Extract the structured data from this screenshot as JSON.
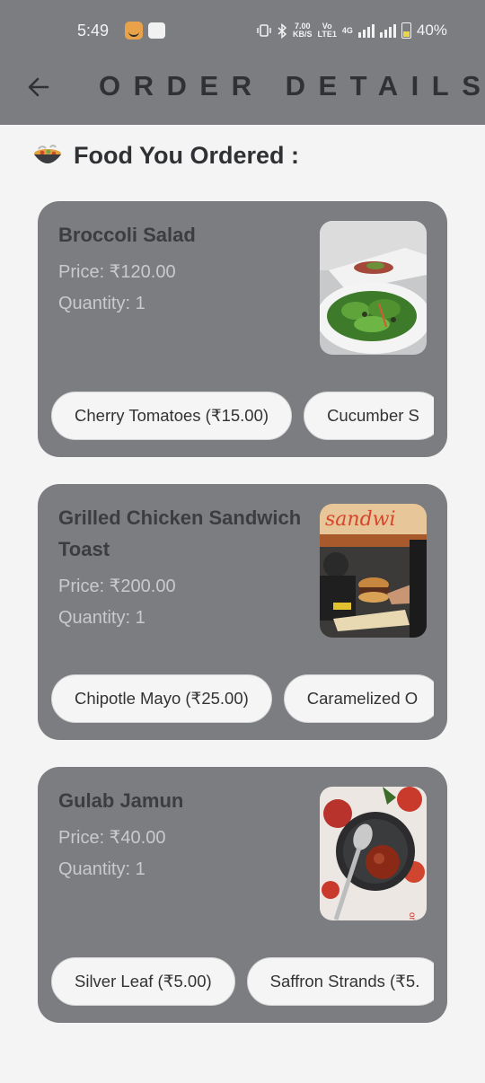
{
  "status_bar": {
    "time": "5:49",
    "speed_top": "7.00",
    "speed_bottom": "KB/S",
    "volte_top": "Vo",
    "volte_bottom": "LTE1",
    "network": "4G",
    "battery_percent": "40%"
  },
  "app_bar": {
    "title": "ORDER DETAILS"
  },
  "section": {
    "heading": "Food You Ordered :",
    "icon": "food-bowl-icon"
  },
  "orders": [
    {
      "name": "Broccoli Salad",
      "price": "Price: ₹120.00",
      "quantity": "Quantity: 1",
      "addons": [
        "Cherry Tomatoes (₹15.00)",
        "Cucumber S"
      ]
    },
    {
      "name": "Grilled Chicken Sandwich Toast",
      "price": "Price: ₹200.00",
      "quantity": "Quantity: 1",
      "addons": [
        "Chipotle Mayo (₹25.00)",
        "Caramelized O"
      ]
    },
    {
      "name": "Gulab Jamun",
      "price": "Price: ₹40.00",
      "quantity": "Quantity: 1",
      "addons": [
        "Silver Leaf (₹5.00)",
        "Saffron Strands (₹5."
      ]
    }
  ],
  "colors": {
    "app_bar": "#7b7d80",
    "card": "#7b7d80",
    "background": "#f4f4f4",
    "chip": "#f5f5f5"
  }
}
